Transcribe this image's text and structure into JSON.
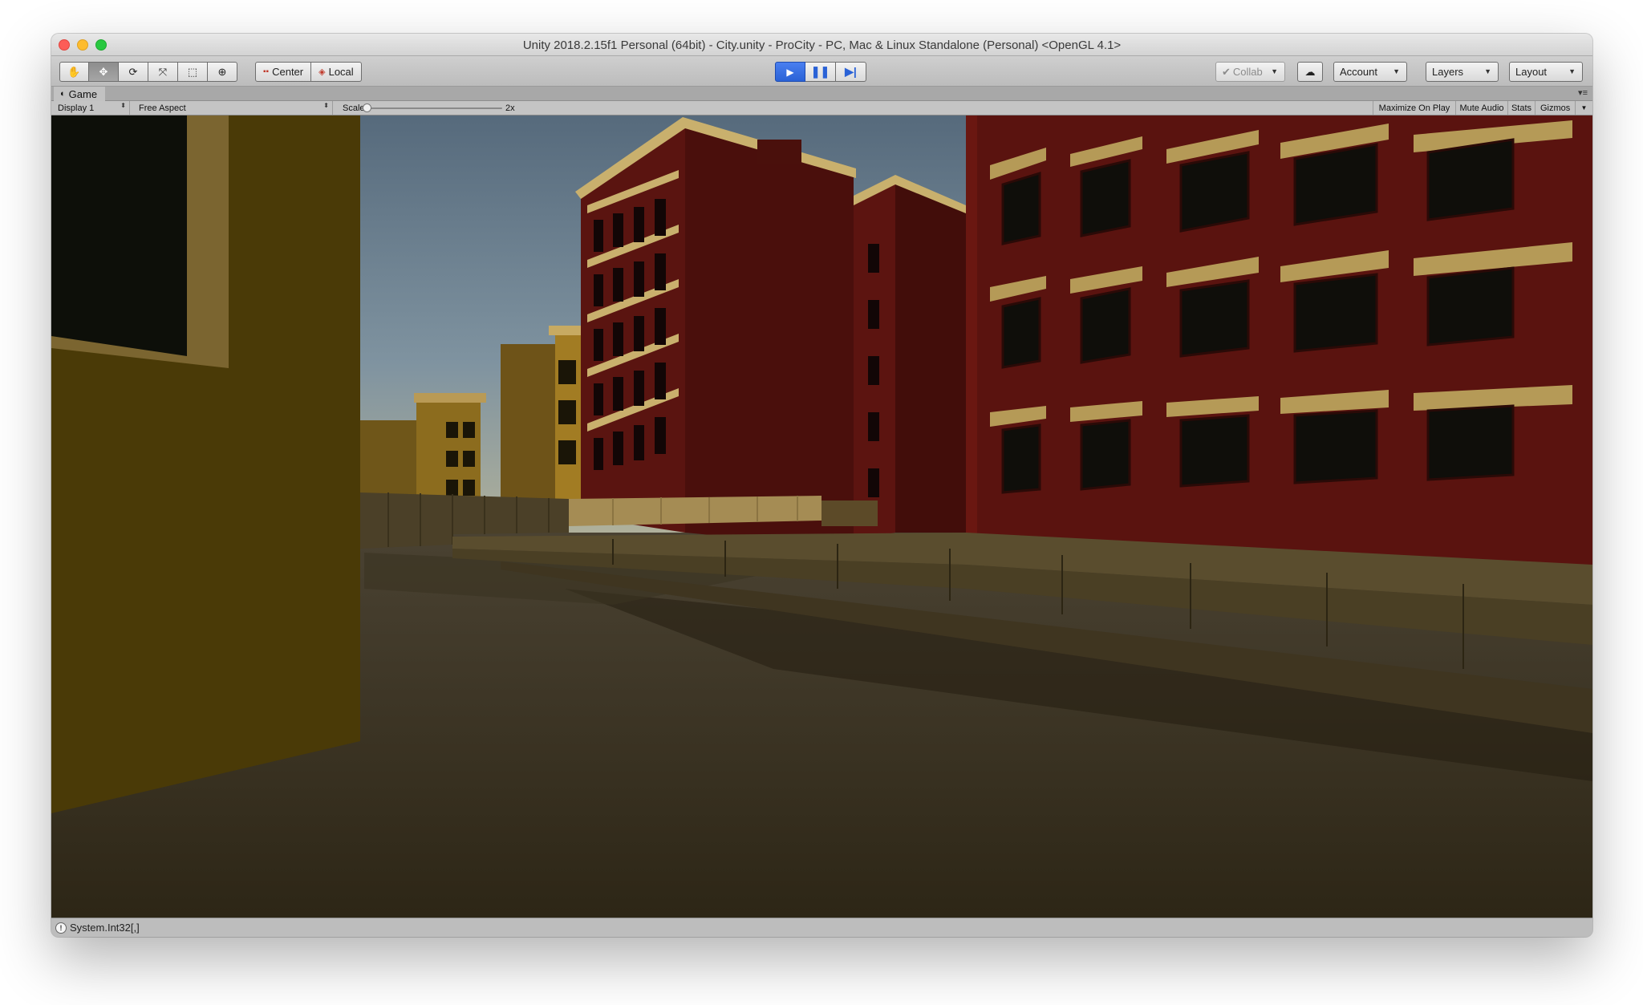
{
  "window": {
    "title": "Unity 2018.2.15f1 Personal (64bit) - City.unity - ProCity - PC, Mac & Linux Standalone (Personal) <OpenGL 4.1>"
  },
  "toolbar": {
    "tools": [
      {
        "name": "hand-tool-button",
        "icon": "hand-icon",
        "glyph": "✋"
      },
      {
        "name": "move-tool-button",
        "icon": "move-icon",
        "glyph": "✥",
        "selected": true
      },
      {
        "name": "rotate-tool-button",
        "icon": "rotate-icon",
        "glyph": "⟳"
      },
      {
        "name": "scale-tool-button",
        "icon": "scale-icon",
        "glyph": "⤧"
      },
      {
        "name": "rect-tool-button",
        "icon": "rect-icon",
        "glyph": "⬚"
      },
      {
        "name": "transform-tool-button",
        "icon": "transform-icon",
        "glyph": "⊕"
      }
    ],
    "pivot_label": "Center",
    "pivot_icon": "pivot-icon",
    "rotation_label": "Local",
    "rotation_icon": "rotation-icon",
    "play_icon": "play-icon",
    "pause_icon": "pause-icon",
    "step_icon": "step-icon",
    "collab_label": "Collab",
    "collab_icon": "checkmark-icon",
    "cloud_icon": "cloud-icon",
    "account_label": "Account",
    "layers_label": "Layers",
    "layout_label": "Layout",
    "colors": {
      "play_active": "#2a62d6"
    }
  },
  "game_panel": {
    "tab_label": "Game",
    "tab_icon": "game-icon",
    "display": "Display 1",
    "aspect": "Free Aspect",
    "scale_label": "Scale",
    "scale_value": "2x",
    "scale_level": 0.0,
    "maximize_label": "Maximize On Play",
    "mute_label": "Mute Audio",
    "stats_label": "Stats",
    "gizmos_label": "Gizmos"
  },
  "status": {
    "message": "System.Int32[,]",
    "icon": "info-icon"
  }
}
